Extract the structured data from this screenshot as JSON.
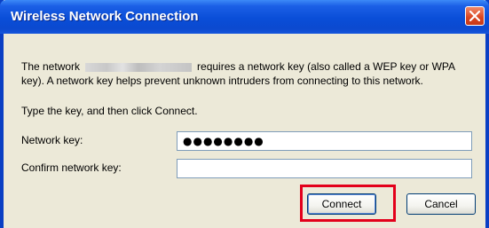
{
  "window": {
    "title": "Wireless Network Connection"
  },
  "message": {
    "before": "The network",
    "after": "requires a network key (also called a WEP key or WPA key). A network key helps prevent unknown intruders from connecting to this network."
  },
  "instruction": "Type the key, and then click Connect.",
  "fields": {
    "network_key": {
      "label": "Network key:",
      "value": "●●●●●●●●"
    },
    "confirm_key": {
      "label": "Confirm network key:",
      "value": ""
    }
  },
  "buttons": {
    "connect": "Connect",
    "cancel": "Cancel"
  },
  "colors": {
    "titlebar": "#0a4ed8",
    "dialog_bg": "#ece9d8",
    "highlight": "#e3001b"
  },
  "icons": {
    "close": "close-icon"
  }
}
